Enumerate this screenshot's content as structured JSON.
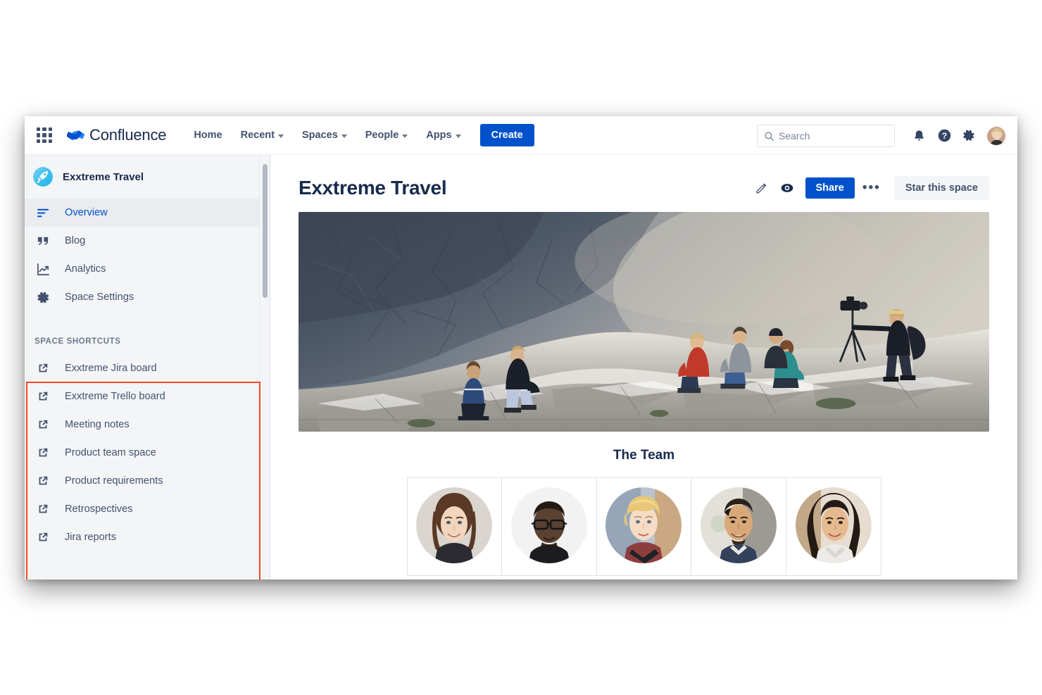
{
  "app": {
    "brand": "Confluence",
    "app_switcher_icon": "grid-apps-icon"
  },
  "top_nav": {
    "links": [
      {
        "label": "Home",
        "has_caret": false
      },
      {
        "label": "Recent",
        "has_caret": true
      },
      {
        "label": "Spaces",
        "has_caret": true
      },
      {
        "label": "People",
        "has_caret": true
      },
      {
        "label": "Apps",
        "has_caret": true
      }
    ],
    "create_label": "Create",
    "search": {
      "placeholder": "Search",
      "value": "",
      "icon": "search-icon"
    },
    "icons": [
      {
        "name": "notifications-bell-icon"
      },
      {
        "name": "help-question-icon"
      },
      {
        "name": "settings-gear-icon"
      },
      {
        "name": "user-avatar"
      }
    ]
  },
  "sidebar": {
    "space_name": "Exxtreme Travel",
    "space_avatar_icon": "space-rocket-avatar",
    "items": [
      {
        "label": "Overview",
        "icon": "overview-lines-icon",
        "active": true
      },
      {
        "label": "Blog",
        "icon": "blog-quote-icon",
        "active": false
      },
      {
        "label": "Analytics",
        "icon": "analytics-chart-icon",
        "active": false
      },
      {
        "label": "Space Settings",
        "icon": "settings-gear-icon",
        "active": false
      }
    ],
    "shortcuts_title": "SPACE SHORTCUTS",
    "shortcuts": [
      {
        "label": "Exxtreme Jira board",
        "icon": "external-link-icon"
      },
      {
        "label": "Exxtreme Trello board",
        "icon": "external-link-icon"
      },
      {
        "label": "Meeting notes",
        "icon": "external-link-icon"
      },
      {
        "label": "Product team space",
        "icon": "external-link-icon"
      },
      {
        "label": "Product requirements",
        "icon": "external-link-icon"
      },
      {
        "label": "Retrospectives",
        "icon": "external-link-icon"
      },
      {
        "label": "Jira reports",
        "icon": "external-link-icon"
      }
    ]
  },
  "page": {
    "title": "Exxtreme Travel",
    "actions": {
      "edit_icon": "pencil-edit-icon",
      "watch_icon": "eye-watch-icon",
      "share_label": "Share",
      "more_label": "•••",
      "star_label": "Star this space"
    },
    "hero_image_alt": "people-on-rocky-cliff-photo",
    "team_heading": "The Team",
    "team_members": [
      {
        "avatar": "team-member-avatar-1"
      },
      {
        "avatar": "team-member-avatar-2"
      },
      {
        "avatar": "team-member-avatar-3"
      },
      {
        "avatar": "team-member-avatar-4"
      },
      {
        "avatar": "team-member-avatar-5"
      }
    ]
  },
  "annotation": {
    "highlight_color": "#ef4a28",
    "target": "space-shortcuts-section"
  },
  "colors": {
    "brand_blue": "#0052cc",
    "sidebar_bg": "#f4f5f7",
    "text_dark": "#172b4d",
    "text_muted": "#42526e",
    "border": "#dfe1e6"
  }
}
